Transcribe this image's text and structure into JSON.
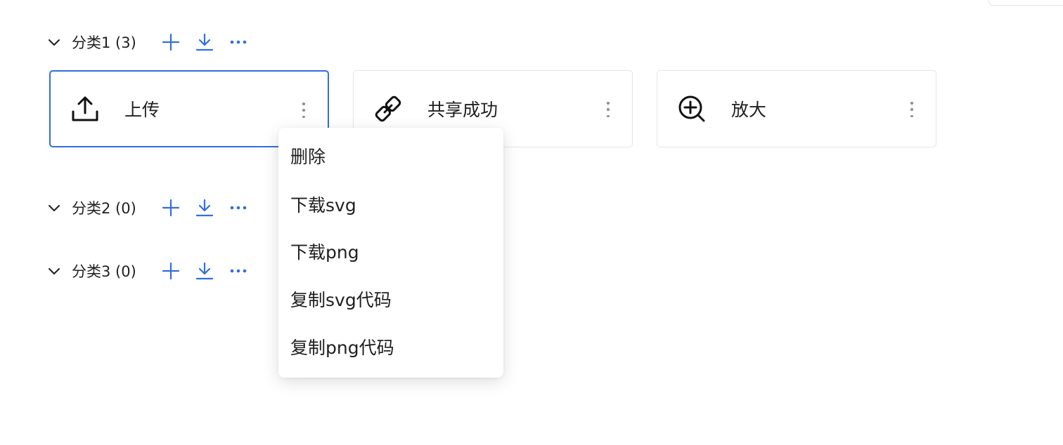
{
  "categories": [
    {
      "title": "分类1 (3)"
    },
    {
      "title": "分类2 (0)"
    },
    {
      "title": "分类3 (0)"
    }
  ],
  "icons": {
    "header_actions": [
      "plus-icon",
      "download-icon",
      "more-horizontal-icon"
    ],
    "collapse": "chevron-down-icon",
    "card_more": "more-vertical-icon"
  },
  "cards": [
    {
      "label": "上传",
      "icon": "upload-icon",
      "selected": true
    },
    {
      "label": "共享成功",
      "icon": "link-icon",
      "selected": false
    },
    {
      "label": "放大",
      "icon": "zoom-in-icon",
      "selected": false
    }
  ],
  "context_menu": {
    "items": [
      "删除",
      "下载svg",
      "下载png",
      "复制svg代码",
      "复制png代码"
    ]
  },
  "colors": {
    "accent": "#2f6fde",
    "border": "#e4e4e4",
    "text": "#1f1f1f",
    "muted": "#8f8f8f"
  }
}
